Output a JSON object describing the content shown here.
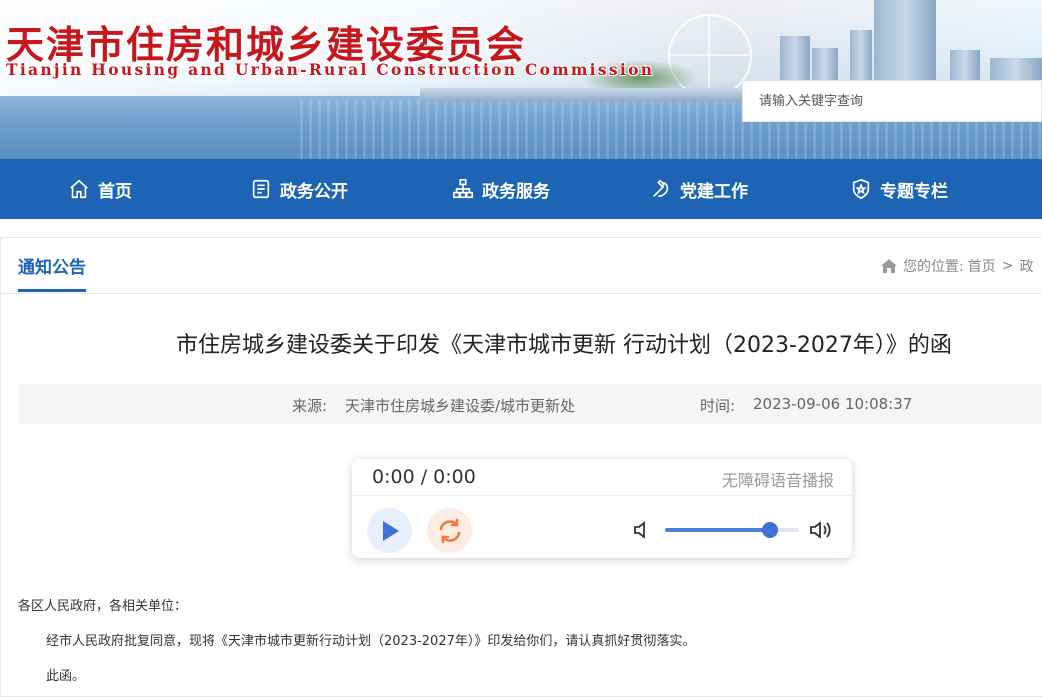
{
  "header": {
    "title_cn": "天津市住房和城乡建设委员会",
    "title_en": "Tianjin Housing and Urban-Rural Construction Commission",
    "search_placeholder": "请输入关键字查询"
  },
  "nav": {
    "items": [
      {
        "label": "首页",
        "icon": "home-icon"
      },
      {
        "label": "政务公开",
        "icon": "document-list-icon"
      },
      {
        "label": "政务服务",
        "icon": "org-chart-icon"
      },
      {
        "label": "党建工作",
        "icon": "party-emblem-icon"
      },
      {
        "label": "专题专栏",
        "icon": "shield-star-icon"
      }
    ],
    "color": "#1e64b4"
  },
  "section": {
    "tab_label": "通知公告",
    "breadcrumb": {
      "prefix": "您的位置:",
      "home": "首页",
      "separator": ">",
      "next": "政"
    }
  },
  "article": {
    "title": "市住房城乡建设委关于印发《天津市城市更新 行动计划（2023-2027年）》的函",
    "source_label": "来源:",
    "source": "天津市住房城乡建设委/城市更新处",
    "time_label": "时间:",
    "time": "2023-09-06 10:08:37",
    "paragraphs": [
      "各区人民政府，各相关单位：",
      "经市人民政府批复同意，现将《天津市城市更新行动计划（2023-2027年）》印发给你们，请认真抓好贯彻落实。",
      "此函。"
    ]
  },
  "player": {
    "time": "0:00 / 0:00",
    "label": "无障碍语音播报",
    "volume": 0.78,
    "accent": "#4a7fe0"
  },
  "colors": {
    "title_red": "#c8161d",
    "brand_blue": "#1e64b4"
  }
}
